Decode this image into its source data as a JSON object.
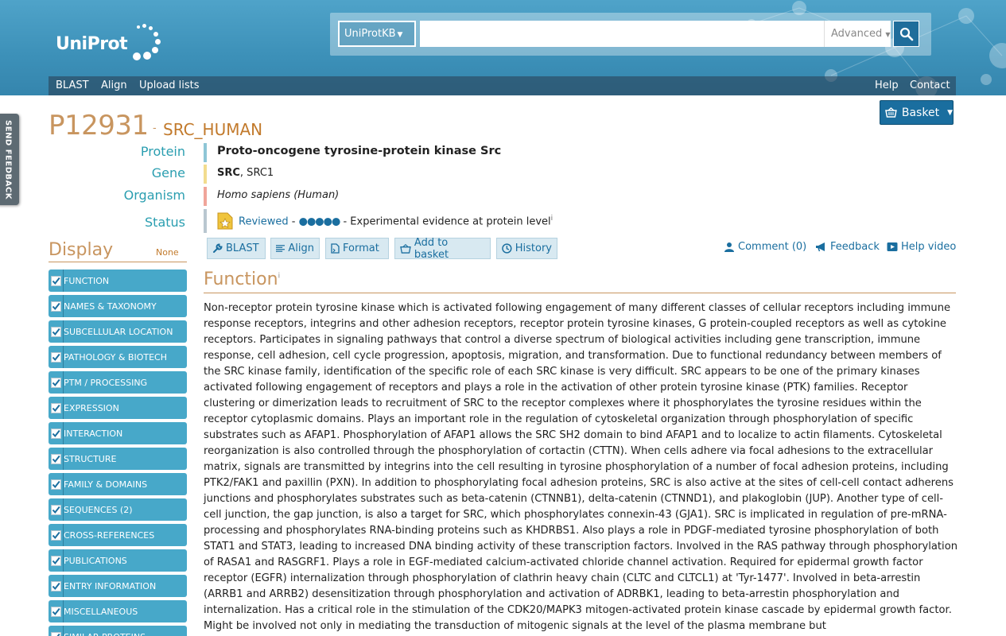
{
  "header": {
    "logo_text": "UniProt",
    "database_select": "UniProtKB",
    "search_placeholder": "",
    "advanced_label": "Advanced",
    "nav_left": [
      "BLAST",
      "Align",
      "Upload lists"
    ],
    "nav_right": [
      "Help",
      "Contact"
    ]
  },
  "feedback_tab": "SEND FEEDBACK",
  "basket_label": "Basket",
  "entry": {
    "accession": "P12931",
    "separator": "-",
    "entry_name": "SRC_HUMAN",
    "protein_label": "Protein",
    "protein_value": "Proto-oncogene tyrosine-protein kinase Src",
    "gene_label": "Gene",
    "gene_primary": "SRC",
    "gene_rest": ", SRC1",
    "organism_label": "Organism",
    "organism_value": "Homo sapiens (Human)",
    "status_label": "Status",
    "status_reviewed": "Reviewed",
    "status_dash": " - ",
    "annotation_score": "●●●●●",
    "status_evidence": " - Experimental evidence at protein level",
    "info_mark": "i"
  },
  "display": {
    "title": "Display",
    "none_label": "None",
    "items": [
      "FUNCTION",
      "NAMES & TAXONOMY",
      "SUBCELLULAR LOCATION",
      "PATHOLOGY & BIOTECH",
      "PTM / PROCESSING",
      "EXPRESSION",
      "INTERACTION",
      "STRUCTURE",
      "FAMILY & DOMAINS",
      "SEQUENCES (2)",
      "CROSS-REFERENCES",
      "PUBLICATIONS",
      "ENTRY INFORMATION",
      "MISCELLANEOUS",
      "SIMILAR PROTEINS"
    ]
  },
  "toolbar": {
    "blast": "BLAST",
    "align": "Align",
    "format": "Format",
    "add_basket": "Add to basket",
    "history": "History",
    "comment": "Comment (0)",
    "feedback": "Feedback",
    "help_video": "Help video"
  },
  "function_section": {
    "title": "Function",
    "info_mark": "i",
    "text": "Non-receptor protein tyrosine kinase which is activated following engagement of many different classes of cellular receptors including immune response receptors, integrins and other adhesion receptors, receptor protein tyrosine kinases, G protein-coupled receptors as well as cytokine receptors. Participates in signaling pathways that control a diverse spectrum of biological activities including gene transcription, immune response, cell adhesion, cell cycle progression, apoptosis, migration, and transformation. Due to functional redundancy between members of the SRC kinase family, identification of the specific role of each SRC kinase is very difficult. SRC appears to be one of the primary kinases activated following engagement of receptors and plays a role in the activation of other protein tyrosine kinase (PTK) families. Receptor clustering or dimerization leads to recruitment of SRC to the receptor complexes where it phosphorylates the tyrosine residues within the receptor cytoplasmic domains. Plays an important role in the regulation of cytoskeletal organization through phosphorylation of specific substrates such as AFAP1. Phosphorylation of AFAP1 allows the SRC SH2 domain to bind AFAP1 and to localize to actin filaments. Cytoskeletal reorganization is also controlled through the phosphorylation of cortactin (CTTN). When cells adhere via focal adhesions to the extracellular matrix, signals are transmitted by integrins into the cell resulting in tyrosine phosphorylation of a number of focal adhesion proteins, including PTK2/FAK1 and paxillin (PXN). In addition to phosphorylating focal adhesion proteins, SRC is also active at the sites of cell-cell contact adherens junctions and phosphorylates substrates such as beta-catenin (CTNNB1), delta-catenin (CTNND1), and plakoglobin (JUP). Another type of cell-cell junction, the gap junction, is also a target for SRC, which phosphorylates connexin-43 (GJA1). SRC is implicated in regulation of pre-mRNA-processing and phosphorylates RNA-binding proteins such as KHDRBS1. Also plays a role in PDGF-mediated tyrosine phosphorylation of both STAT1 and STAT3, leading to increased DNA binding activity of these transcription factors. Involved in the RAS pathway through phosphorylation of RASA1 and RASGRF1. Plays a role in EGF-mediated calcium-activated chloride channel activation. Required for epidermal growth factor receptor (EGFR) internalization through phosphorylation of clathrin heavy chain (CLTC and CLTCL1) at 'Tyr-1477'. Involved in beta-arrestin (ARRB1 and ARRB2) desensitization through phosphorylation and activation of ADRBK1, leading to beta-arrestin phosphorylation and internalization. Has a critical role in the stimulation of the CDK20/MAPK3 mitogen-activated protein kinase cascade by epidermal growth factor. Might be involved not only in mediating the transduction of mitogenic signals at the level of the plasma membrane but"
  },
  "colors": {
    "header_blue": "#3c90b8",
    "accent_orange": "#c8955f",
    "label_teal": "#2a9eb0",
    "sidebar_blue": "#47a8c9",
    "link_blue": "#1a6e9f"
  }
}
